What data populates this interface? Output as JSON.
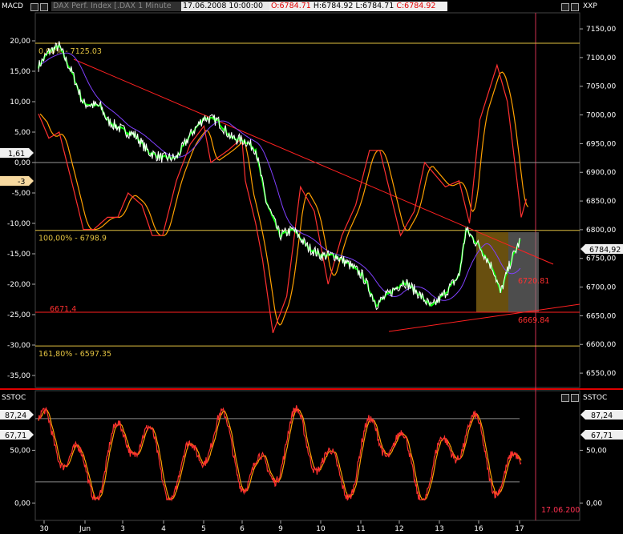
{
  "header": {
    "indicator": "MACD",
    "title": "DAX Perf. Index [.DAX  1 Minute",
    "date": "17.06.2008 10:00:00",
    "ohlc": {
      "o": "O:6784.71",
      "h": "H:6784.92",
      "l": "L:6784.71",
      "c": "C:6784.92"
    },
    "right_label": "XXP"
  },
  "lower_panel": {
    "left_label": "SSTOC",
    "right_label": "SSTOC"
  },
  "markers": {
    "macd_left_1": "1,61",
    "macd_left_2": "-3",
    "price_right": "6784,92",
    "stoch_left_1": "87,24",
    "stoch_left_2": "67,71",
    "stoch_right_1": "87,24",
    "stoch_right_2": "67,71",
    "cursor_date": "17.06.200"
  },
  "colors": {
    "price": "#ffffff",
    "price_ma": "#00ff00",
    "macd": "#ff3030",
    "macd_signal": "#ffa000",
    "fib": "#e0c040",
    "trend": "#ff2020",
    "box": "#b8860b"
  },
  "chart_data": [
    {
      "type": "line",
      "name": "main-price-chart",
      "x_ticks": [
        "30",
        "Jun",
        "3",
        "4",
        "5",
        "6",
        "9",
        "10",
        "11",
        "12",
        "13",
        "16",
        "17"
      ],
      "y_right_ticks": [
        "7150,00",
        "7100,00",
        "7050,00",
        "7000,00",
        "6950,00",
        "6900,00",
        "6850,00",
        "6800,00",
        "6750,00",
        "6700,00",
        "6650,00",
        "6600,00",
        "6550,00"
      ],
      "y_left_ticks": [
        "20,00",
        "15,00",
        "10,00",
        "5,00",
        "0,00",
        "-5,00",
        "-10,00",
        "-15,00",
        "-20,00",
        "-25,00",
        "-30,00",
        "-35,00"
      ],
      "y_right_range": [
        6525,
        7178
      ],
      "price_points": [
        [
          0,
          7085
        ],
        [
          0.3,
          7110
        ],
        [
          0.6,
          7120
        ],
        [
          1,
          7070
        ],
        [
          1.3,
          7020
        ],
        [
          1.8,
          7015
        ],
        [
          2,
          6990
        ],
        [
          2.4,
          6975
        ],
        [
          2.8,
          6965
        ],
        [
          3.2,
          6935
        ],
        [
          3.6,
          6925
        ],
        [
          4,
          6925
        ],
        [
          4.4,
          6965
        ],
        [
          4.8,
          6995
        ],
        [
          5.2,
          6990
        ],
        [
          5.6,
          6960
        ],
        [
          6,
          6955
        ],
        [
          6.3,
          6940
        ],
        [
          6.6,
          6850
        ],
        [
          7,
          6790
        ],
        [
          7.4,
          6800
        ],
        [
          7.8,
          6770
        ],
        [
          8.2,
          6755
        ],
        [
          8.6,
          6755
        ],
        [
          9,
          6740
        ],
        [
          9.4,
          6720
        ],
        [
          9.8,
          6670
        ],
        [
          10.2,
          6690
        ],
        [
          10.6,
          6710
        ],
        [
          11,
          6690
        ],
        [
          11.4,
          6665
        ],
        [
          11.8,
          6690
        ],
        [
          12.2,
          6720
        ],
        [
          12.4,
          6800
        ],
        [
          12.8,
          6770
        ],
        [
          13.2,
          6730
        ],
        [
          13.4,
          6690
        ],
        [
          13.7,
          6745
        ],
        [
          14,
          6785
        ]
      ],
      "macd_points": [
        [
          0,
          8
        ],
        [
          0.3,
          4
        ],
        [
          0.6,
          5
        ],
        [
          1,
          -4
        ],
        [
          1.3,
          -11
        ],
        [
          1.6,
          -11
        ],
        [
          2,
          -9
        ],
        [
          2.3,
          -9
        ],
        [
          2.6,
          -5
        ],
        [
          3,
          -7
        ],
        [
          3.3,
          -12
        ],
        [
          3.6,
          -12
        ],
        [
          4,
          -3
        ],
        [
          4.4,
          3
        ],
        [
          4.8,
          6
        ],
        [
          5,
          0
        ],
        [
          5.5,
          2
        ],
        [
          5.9,
          4
        ],
        [
          6,
          -3
        ],
        [
          6.3,
          -10
        ],
        [
          6.5,
          -16
        ],
        [
          6.8,
          -28
        ],
        [
          7.2,
          -22
        ],
        [
          7.6,
          -4
        ],
        [
          8,
          -8
        ],
        [
          8.4,
          -20
        ],
        [
          8.8,
          -12
        ],
        [
          9.2,
          -7
        ],
        [
          9.6,
          2
        ],
        [
          9.9,
          2
        ],
        [
          10.2,
          -5
        ],
        [
          10.5,
          -12
        ],
        [
          10.9,
          -8
        ],
        [
          11.2,
          0
        ],
        [
          11.5,
          -2
        ],
        [
          11.8,
          -4
        ],
        [
          12.2,
          -3
        ],
        [
          12.5,
          -10
        ],
        [
          12.8,
          7
        ],
        [
          13.3,
          16
        ],
        [
          13.6,
          10
        ],
        [
          13.9,
          -4
        ],
        [
          14,
          -9
        ],
        [
          14.2,
          -5
        ]
      ],
      "fib_levels": [
        {
          "label": "0,00% - 7125.03",
          "value": 7125.03
        },
        {
          "label": "100,00% - 6798.9",
          "value": 6798.9
        },
        {
          "label": "161,80% - 6597.35",
          "value": 6597.35
        }
      ],
      "annotations": [
        "6671,4",
        "6720.81",
        "6669.84"
      ]
    },
    {
      "type": "line",
      "name": "slow-stochastic",
      "y_ticks": [
        "50,00",
        "0,00"
      ],
      "y_range": [
        -15,
        105
      ],
      "overbought": 80,
      "oversold": 20
    }
  ]
}
